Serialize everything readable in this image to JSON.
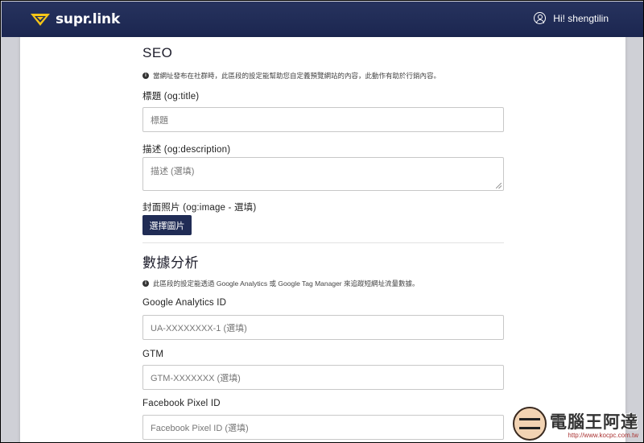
{
  "header": {
    "brand": "supr.link",
    "greeting": "Hi! shengtilin"
  },
  "seo": {
    "title": "SEO",
    "notice": "當網址發布在社群時，此區段的設定能幫助您自定義預覽網站的內容，此動作有助於行銷內容。",
    "og_title_label": "標題 (og:title)",
    "og_title_placeholder": "標題",
    "og_description_label": "描述 (og:description)",
    "og_description_placeholder": "描述 (選填)",
    "og_image_label": "封面照片 (og:image - 選填)",
    "choose_image_button": "選擇圖片"
  },
  "analytics": {
    "title": "數據分析",
    "notice": "此區段的設定能透過 Google Analytics 或 Google Tag Manager 來追蹤短網址流量數據。",
    "ga_label": "Google Analytics ID",
    "ga_placeholder": "UA-XXXXXXXX-1 (選填)",
    "gtm_label": "GTM",
    "gtm_placeholder": "GTM-XXXXXXX (選填)",
    "fb_label": "Facebook Pixel ID",
    "fb_placeholder": "Facebook Pixel ID (選填)"
  },
  "watermark": {
    "title": "電腦王阿達",
    "url": "http://www.kocpc.com.tw"
  },
  "colors": {
    "header_bg": "#202c55",
    "button_bg": "#202c55",
    "logo_yellow": "#f5c518"
  }
}
